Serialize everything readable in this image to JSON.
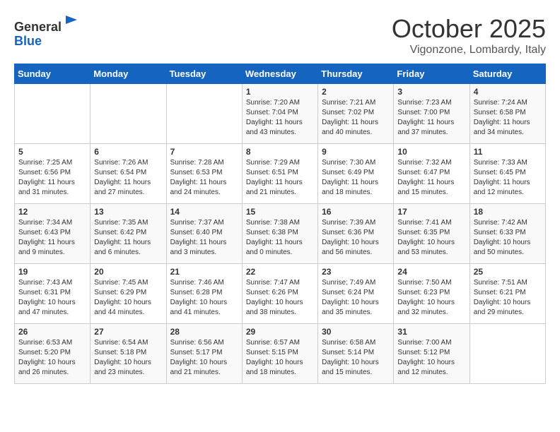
{
  "header": {
    "logo_line1": "General",
    "logo_line2": "Blue",
    "month": "October 2025",
    "location": "Vigonzone, Lombardy, Italy"
  },
  "days_of_week": [
    "Sunday",
    "Monday",
    "Tuesday",
    "Wednesday",
    "Thursday",
    "Friday",
    "Saturday"
  ],
  "weeks": [
    [
      {
        "day": "",
        "content": ""
      },
      {
        "day": "",
        "content": ""
      },
      {
        "day": "",
        "content": ""
      },
      {
        "day": "1",
        "content": "Sunrise: 7:20 AM\nSunset: 7:04 PM\nDaylight: 11 hours and 43 minutes."
      },
      {
        "day": "2",
        "content": "Sunrise: 7:21 AM\nSunset: 7:02 PM\nDaylight: 11 hours and 40 minutes."
      },
      {
        "day": "3",
        "content": "Sunrise: 7:23 AM\nSunset: 7:00 PM\nDaylight: 11 hours and 37 minutes."
      },
      {
        "day": "4",
        "content": "Sunrise: 7:24 AM\nSunset: 6:58 PM\nDaylight: 11 hours and 34 minutes."
      }
    ],
    [
      {
        "day": "5",
        "content": "Sunrise: 7:25 AM\nSunset: 6:56 PM\nDaylight: 11 hours and 31 minutes."
      },
      {
        "day": "6",
        "content": "Sunrise: 7:26 AM\nSunset: 6:54 PM\nDaylight: 11 hours and 27 minutes."
      },
      {
        "day": "7",
        "content": "Sunrise: 7:28 AM\nSunset: 6:53 PM\nDaylight: 11 hours and 24 minutes."
      },
      {
        "day": "8",
        "content": "Sunrise: 7:29 AM\nSunset: 6:51 PM\nDaylight: 11 hours and 21 minutes."
      },
      {
        "day": "9",
        "content": "Sunrise: 7:30 AM\nSunset: 6:49 PM\nDaylight: 11 hours and 18 minutes."
      },
      {
        "day": "10",
        "content": "Sunrise: 7:32 AM\nSunset: 6:47 PM\nDaylight: 11 hours and 15 minutes."
      },
      {
        "day": "11",
        "content": "Sunrise: 7:33 AM\nSunset: 6:45 PM\nDaylight: 11 hours and 12 minutes."
      }
    ],
    [
      {
        "day": "12",
        "content": "Sunrise: 7:34 AM\nSunset: 6:43 PM\nDaylight: 11 hours and 9 minutes."
      },
      {
        "day": "13",
        "content": "Sunrise: 7:35 AM\nSunset: 6:42 PM\nDaylight: 11 hours and 6 minutes."
      },
      {
        "day": "14",
        "content": "Sunrise: 7:37 AM\nSunset: 6:40 PM\nDaylight: 11 hours and 3 minutes."
      },
      {
        "day": "15",
        "content": "Sunrise: 7:38 AM\nSunset: 6:38 PM\nDaylight: 11 hours and 0 minutes."
      },
      {
        "day": "16",
        "content": "Sunrise: 7:39 AM\nSunset: 6:36 PM\nDaylight: 10 hours and 56 minutes."
      },
      {
        "day": "17",
        "content": "Sunrise: 7:41 AM\nSunset: 6:35 PM\nDaylight: 10 hours and 53 minutes."
      },
      {
        "day": "18",
        "content": "Sunrise: 7:42 AM\nSunset: 6:33 PM\nDaylight: 10 hours and 50 minutes."
      }
    ],
    [
      {
        "day": "19",
        "content": "Sunrise: 7:43 AM\nSunset: 6:31 PM\nDaylight: 10 hours and 47 minutes."
      },
      {
        "day": "20",
        "content": "Sunrise: 7:45 AM\nSunset: 6:29 PM\nDaylight: 10 hours and 44 minutes."
      },
      {
        "day": "21",
        "content": "Sunrise: 7:46 AM\nSunset: 6:28 PM\nDaylight: 10 hours and 41 minutes."
      },
      {
        "day": "22",
        "content": "Sunrise: 7:47 AM\nSunset: 6:26 PM\nDaylight: 10 hours and 38 minutes."
      },
      {
        "day": "23",
        "content": "Sunrise: 7:49 AM\nSunset: 6:24 PM\nDaylight: 10 hours and 35 minutes."
      },
      {
        "day": "24",
        "content": "Sunrise: 7:50 AM\nSunset: 6:23 PM\nDaylight: 10 hours and 32 minutes."
      },
      {
        "day": "25",
        "content": "Sunrise: 7:51 AM\nSunset: 6:21 PM\nDaylight: 10 hours and 29 minutes."
      }
    ],
    [
      {
        "day": "26",
        "content": "Sunrise: 6:53 AM\nSunset: 5:20 PM\nDaylight: 10 hours and 26 minutes."
      },
      {
        "day": "27",
        "content": "Sunrise: 6:54 AM\nSunset: 5:18 PM\nDaylight: 10 hours and 23 minutes."
      },
      {
        "day": "28",
        "content": "Sunrise: 6:56 AM\nSunset: 5:17 PM\nDaylight: 10 hours and 21 minutes."
      },
      {
        "day": "29",
        "content": "Sunrise: 6:57 AM\nSunset: 5:15 PM\nDaylight: 10 hours and 18 minutes."
      },
      {
        "day": "30",
        "content": "Sunrise: 6:58 AM\nSunset: 5:14 PM\nDaylight: 10 hours and 15 minutes."
      },
      {
        "day": "31",
        "content": "Sunrise: 7:00 AM\nSunset: 5:12 PM\nDaylight: 10 hours and 12 minutes."
      },
      {
        "day": "",
        "content": ""
      }
    ]
  ]
}
